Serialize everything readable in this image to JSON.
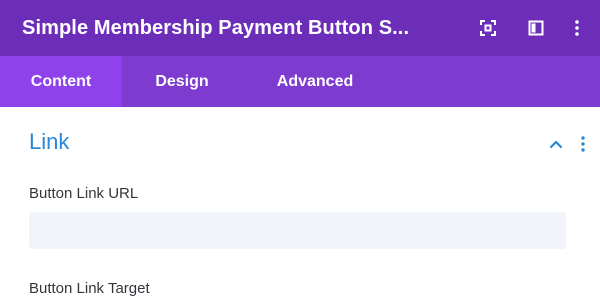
{
  "header": {
    "title": "Simple Membership Payment Button S...",
    "background": "#6c2eb9",
    "icons": [
      "focus-icon",
      "split-view-icon",
      "more-vertical-icon"
    ]
  },
  "tabs": [
    {
      "label": "Content",
      "active": true
    },
    {
      "label": "Design",
      "active": false
    },
    {
      "label": "Advanced",
      "active": false
    }
  ],
  "section": {
    "title": "Link",
    "expanded": true,
    "accent": "#2b87da",
    "icons": [
      "chevron-up-icon",
      "more-vertical-icon"
    ]
  },
  "fields": {
    "url_label": "Button Link URL",
    "url_value": "",
    "url_placeholder": "",
    "target_label": "Button Link Target"
  }
}
